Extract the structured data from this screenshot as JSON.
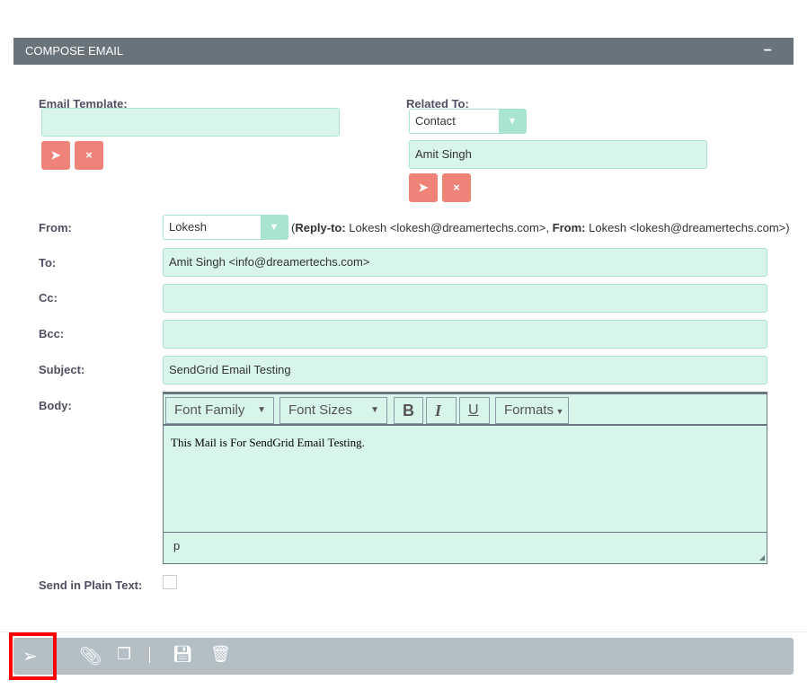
{
  "header": {
    "title": "COMPOSE EMAIL",
    "collapse": "−"
  },
  "email_template": {
    "label": "Email Template:",
    "value": ""
  },
  "related_to": {
    "label": "Related To:",
    "type": "Contact",
    "value": "Amit Singh"
  },
  "from": {
    "label": "From:",
    "value": "Lokesh",
    "reply_to_label": "Reply-to:",
    "reply_to": " Lokesh <lokesh@dreamertechs.com>, ",
    "from_label": "From:",
    "from_info": " Lokesh <lokesh@dreamertechs.com>)"
  },
  "to": {
    "label": "To:",
    "value": "Amit Singh <info@dreamertechs.com>"
  },
  "cc": {
    "label": "Cc:",
    "value": ""
  },
  "bcc": {
    "label": "Bcc:",
    "value": ""
  },
  "subject": {
    "label": "Subject:",
    "value": "SendGrid Email Testing"
  },
  "body": {
    "label": "Body:",
    "font_family": "Font Family",
    "font_sizes": "Font Sizes",
    "bold": "B",
    "italic": "I",
    "underline": "U",
    "formats": "Formats",
    "text": "This Mail is For SendGrid Email Testing.",
    "path": "p"
  },
  "plain_text": {
    "label": "Send in Plain Text:",
    "checked": false
  },
  "colors": {
    "header": "#69737c",
    "field": "#d8f5ec",
    "danger": "#f08377",
    "actionbar": "#b3bec5",
    "highlight": "#ff0000"
  }
}
